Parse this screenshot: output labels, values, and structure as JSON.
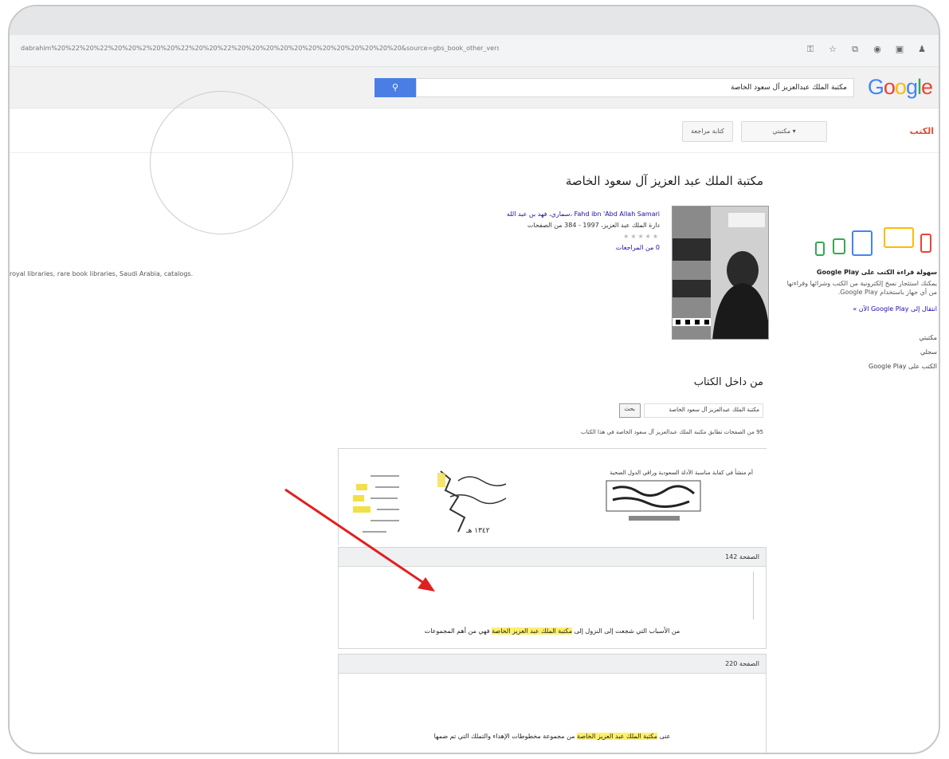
{
  "browser": {
    "url": "dabrahim%20%22%20%22%20%20%2%20%20%22%20%20%22%20%20%20%20%20%20%20%20%20%20%20%20&source=gbs_book_other_versions",
    "toolbar_icons": [
      "lock-icon",
      "bookmark-icon",
      "extension-icon",
      "account-icon",
      "tabs-icon",
      "profile-icon"
    ]
  },
  "google": {
    "logo_letters": [
      {
        "ch": "G",
        "color": "#4285f4"
      },
      {
        "ch": "o",
        "color": "#ea4335"
      },
      {
        "ch": "o",
        "color": "#fbbc05"
      },
      {
        "ch": "g",
        "color": "#4285f4"
      },
      {
        "ch": "l",
        "color": "#34a853"
      },
      {
        "ch": "e",
        "color": "#ea4335"
      }
    ],
    "search_value": "مكتبة الملك عبدالعزيز آل سعود الخاصة",
    "search_btn_icon": "search-icon"
  },
  "subheader": {
    "books_label": "الكتب",
    "my_library": "مكتبتي ▾",
    "write_review": "كتابة مراجعة"
  },
  "left": {
    "keywords": "royal libraries, rare book libraries, Saudi Arabia, catalogs."
  },
  "book": {
    "title": "مكتبة الملك عبد العزيز آل سعود الخاصة",
    "author_line": "Fahd ibn 'Abd Allah Samari ،سماري، فهد بن عبد الله",
    "publisher_line": "دارة الملك عبد العزيز، 1997 - 384 من الصفحات",
    "stars": "★★★★★",
    "reviews": "0 من المراجعات"
  },
  "sidebar": {
    "play_heading": "سهولة قراءة الكتب على Google Play",
    "play_text": "يمكنك استئجار نسخ إلكترونية من الكتب وشرائها وقراءتها من أي جهاز باستخدام Google Play.",
    "play_link": "انتقال إلى Google Play الآن »",
    "menu": [
      "مكتبتي",
      "سجلي",
      "الكتب على Google Play"
    ]
  },
  "inside": {
    "title": "من داخل الكتاب",
    "search_value": "مكتبة الملك عبدالعزيز آل سعود الخاصة",
    "search_btn": "بحث",
    "result_count": "95 من الصفحات تطابق مكتبة الملك عبدالعزيز آل سعود الخاصة في هذا الكتاب",
    "scan_text": "أم منشأ في كفاية مناسبة الأدلة السعودية وراقي الدول الصحية",
    "scan_year": "١٣٤٢ هـ"
  },
  "snippets": [
    {
      "page": "الصفحة 142",
      "before": "من الأسباب التي شجعت إلى النزول إلى",
      "highlight": "مكتبة الملك عبد العزيز الخاصة",
      "after": "فهي من أهم المجموعات"
    },
    {
      "page": "الصفحة 220",
      "before": "عنى",
      "highlight": "مكتبة الملك عبد العزيز الخاصة",
      "after": "من مجموعة مخطوطات الإهداء والتملك التي تم ضمها"
    }
  ]
}
